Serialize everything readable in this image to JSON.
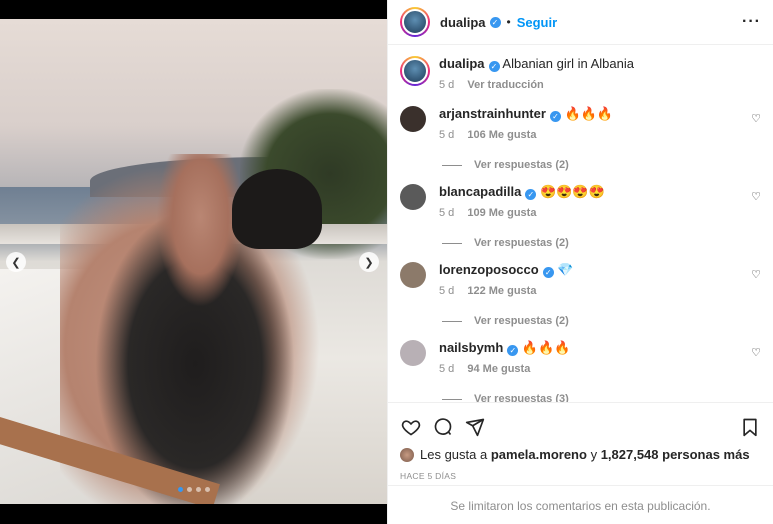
{
  "post": {
    "username": "dualipa",
    "follow_label": "Seguir",
    "more_icon": "more-horizontal-icon"
  },
  "caption": {
    "username": "dualipa",
    "text": "Albanian girl in Albania",
    "time": "5 d",
    "translate_label": "Ver traducción"
  },
  "comments": [
    {
      "username": "arjanstrainhunter",
      "text": "🔥🔥🔥",
      "time": "5 d",
      "likes": "106 Me gusta",
      "replies": "Ver respuestas (2)",
      "avatar_color": "#3a302c"
    },
    {
      "username": "blancapadilla",
      "text": "😍😍😍😍",
      "time": "5 d",
      "likes": "109 Me gusta",
      "replies": "Ver respuestas (2)",
      "avatar_color": "#5a5a5a"
    },
    {
      "username": "lorenzoposocco",
      "text": "💎",
      "time": "5 d",
      "likes": "122 Me gusta",
      "replies": "Ver respuestas (2)",
      "avatar_color": "#8c7a6a"
    },
    {
      "username": "nailsbymh",
      "text": "🔥🔥🔥",
      "time": "5 d",
      "likes": "94 Me gusta",
      "replies": "Ver respuestas (3)",
      "avatar_color": "#b8b0b5"
    }
  ],
  "likes": {
    "prefix": "Les gusta a",
    "user": "pamela.moreno",
    "connector": "y",
    "count": "1,827,548 personas más"
  },
  "timestamp": "HACE 5 DÍAS",
  "comments_limited": "Se limitaron los comentarios en esta publicación.",
  "carousel": {
    "slide_count": 4,
    "active_index": 0
  },
  "colors": {
    "link_blue": "#0095f6",
    "verified_blue": "#3897f0",
    "muted": "#8e8e8e"
  }
}
